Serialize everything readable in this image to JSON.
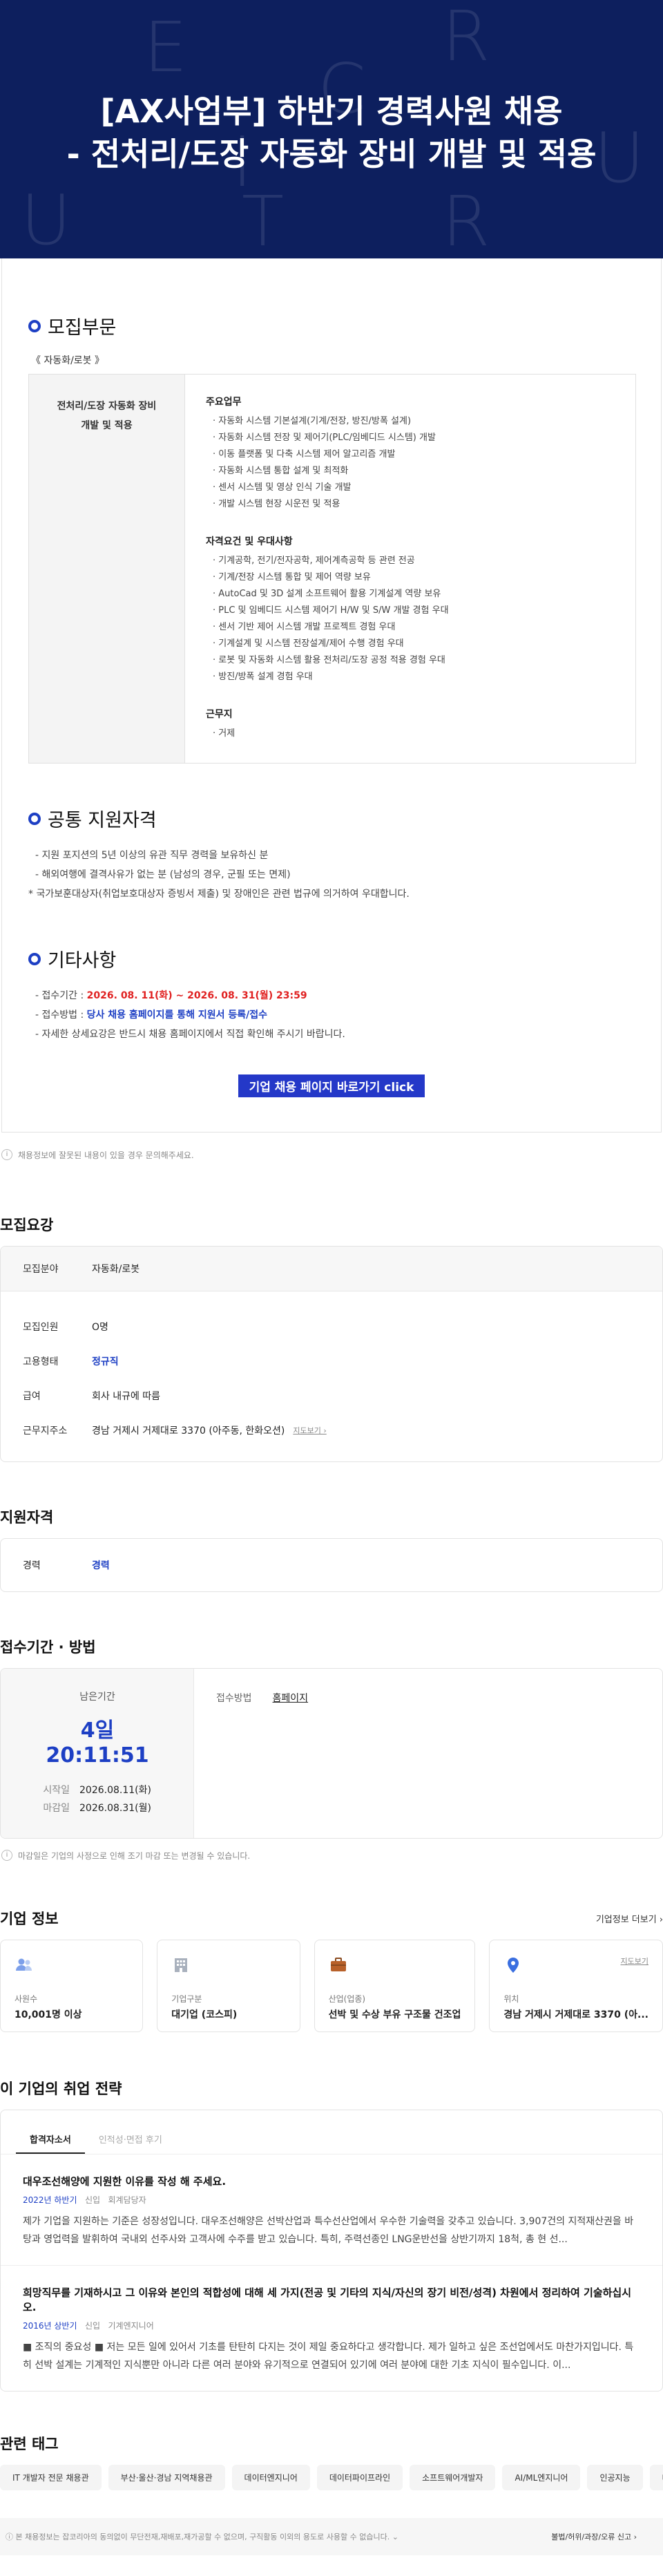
{
  "hero": {
    "title_line1": "[AX사업부] 하반기 경력사원 채용",
    "title_line2": "- 전처리/도장 자동화 장비 개발 및 적용",
    "bg_letters": [
      "E",
      "R",
      "C",
      "U",
      "I",
      "T",
      "R",
      "U"
    ]
  },
  "detail": {
    "sec1_title": "모집부문",
    "category": "《 자동화/로봇 》",
    "job_name_line1": "전처리/도장 자동화 장비",
    "job_name_line2": "개발 및 적용",
    "duties_title": "주요업무",
    "duties": [
      "자동화 시스템 기본설계(기계/전장, 방진/방폭 설계)",
      "자동화 시스템 전장 및 제어기(PLC/임베디드 시스템) 개발",
      "이동 플랫폼 및 다축 시스템 제어 알고리즘 개발",
      "자동화 시스템 통합 설계 및 최적화",
      "센서 시스템 및 영상 인식 기술 개발",
      "개발 시스템 현장 시운전 및 적용"
    ],
    "req_title": "자격요건 및 우대사항",
    "reqs": [
      "기계공학, 전기/전자공학, 제어계측공학 등 관련 전공",
      "기계/전장 시스템 통합 및 제어 역량 보유",
      "AutoCad 및 3D 설계 소프트웨어 활용 기계설계 역량 보유",
      "PLC 및 임베디드 시스템 제어기 H/W 및 S/W 개발 경험 우대",
      "센서 기반 제어 시스템 개발 프로젝트 경험 우대",
      "기계설계 및 시스템 전장설계/제어 수행 경험 우대",
      "로봇 및 자동화 시스템 활용 전처리/도장 공정 적용 경험 우대",
      "방진/방폭 설계 경험 우대"
    ],
    "loc_title": "근무지",
    "locs": [
      "거제"
    ],
    "sec2_title": "공통 지원자격",
    "common": [
      "지원 포지션의 5년 이상의 유관 직무 경력을 보유하신 분",
      "해외여행에 결격사유가 없는 분 (남성의 경우, 군필 또는 면제)"
    ],
    "common_note": "국가보훈대상자(취업보호대상자 증빙서 제출) 및 장애인은 관련 법규에 의거하여 우대합니다.",
    "sec3_title": "기타사항",
    "period_label": "접수기간 : ",
    "period_value": "2026. 08. 11(화) ~ 2026. 08. 31(월) 23:59",
    "method_label": "접수방법 : ",
    "method_value": "당사 채용 홈페이지를 통해 지원서 등록/접수",
    "etc_note": "자세한 상세요강은 반드시 채용 홈페이지에서 직접 확인해 주시기 바랍니다.",
    "apply_button": "기업 채용 페이지 바로가기 click"
  },
  "notice1": "채용정보에 잘못된 내용이 있을 경우 문의해주세요.",
  "summary": {
    "title": "모집요강",
    "field_k": "모집분야",
    "field_v": "자동화/로봇",
    "rows": [
      {
        "k": "모집인원",
        "v": "O명"
      },
      {
        "k": "고용형태",
        "v": "정규직"
      },
      {
        "k": "급여",
        "v": "회사 내규에 따름"
      },
      {
        "k": "근무지주소",
        "v": "경남 거제시 거제대로 3370 (아주동, 한화오션)"
      }
    ],
    "map_btn": "지도보기 ›"
  },
  "qual": {
    "title": "지원자격",
    "k": "경력",
    "v": "경력"
  },
  "period": {
    "title": "접수기간 · 방법",
    "remain_label": "남은기간",
    "countdown": "4일 20:11:51",
    "start_k": "시작일",
    "start_v": "2026.08.11(화)",
    "end_k": "마감일",
    "end_v": "2026.08.31(월)",
    "method_k": "접수방법",
    "method_v": "홈페이지"
  },
  "notice2": "마감일은 기업의 사정으로 인해 조기 마감 또는 변경될 수 있습니다.",
  "company": {
    "title": "기업 정보",
    "more": "기업정보 더보기 ›",
    "cards": [
      {
        "icon": "people-icon",
        "k": "사원수",
        "v": "10,001명 이상"
      },
      {
        "icon": "building-icon",
        "k": "기업구분",
        "v": "대기업 (코스피)"
      },
      {
        "icon": "briefcase-icon",
        "k": "산업(업종)",
        "v": "선박 및 수상 부유 구조물 건조업"
      },
      {
        "icon": "location-pin-icon",
        "k": "위치",
        "v": "경남 거제시 거제대로 3370 (아..."
      }
    ],
    "map_btn": "지도보기"
  },
  "strategy": {
    "title": "이 기업의 취업 전략",
    "tabs": [
      "합격자소서",
      "인적성·면접 후기"
    ],
    "items": [
      {
        "q": "대우조선해양에 지원한 이유를 작성 해 주세요.",
        "year": "2022년 하반기",
        "type": "신입",
        "job": "회계담당자",
        "a": "제가 기업을 지원하는 기준은 성장성입니다. 대우조선해양은 선박산업과 특수선산업에서 우수한 기술력을 갖추고 있습니다. 3,907건의 지적재산권을 바탕과 영업력을 발휘하여 국내외 선주사와 고객사에 수주를 받고 있습니다. 특히, 주력선종인 LNG운반선을 상반기까지 18척, 총 현 선..."
      },
      {
        "q": "희망직무를 기재하시고 그 이유와 본인의 적합성에 대해 세 가지(전공 및 기타의 지식/자신의 장기 비전/성격) 차원에서 정리하여 기술하십시오.",
        "year": "2016년 상반기",
        "type": "신입",
        "job": "기계엔지니어",
        "a": "■ 조직의 중요성 ■ 저는 모든 일에 있어서 기초를 탄탄히 다지는 것이 제일 중요하다고 생각합니다. 제가 일하고 싶은 조선업에서도 마찬가지입니다. 특히 선박 설계는 기계적인 지식뿐만 아니라 다른 여러 분야와 유기적으로 연결되어 있기에 여러 분야에 대한 기초 지식이 필수입니다. 이..."
      }
    ]
  },
  "tags": {
    "title": "관련 태그",
    "items": [
      "IT 개발자 전문 채용관",
      "부산·울산·경남 지역채용관",
      "데이터엔지니어",
      "데이터파이프라인",
      "소프트웨어개발자",
      "AI/ML엔지니어",
      "인공지능",
      "데"
    ]
  },
  "footer": {
    "text": "본 채용정보는 잡코리아의 동의없이 무단전재,재배포,재가공할 수 없으며, 구직활동 이외의 용도로 사용할 수 없습니다.",
    "report": "불법/허위/과장/오류 신고 ›"
  },
  "colors": {
    "hero_bg": "#0d1f5e",
    "accent": "#1d3fc4",
    "deadline_red": "#e02020",
    "button": "#2438c8"
  }
}
